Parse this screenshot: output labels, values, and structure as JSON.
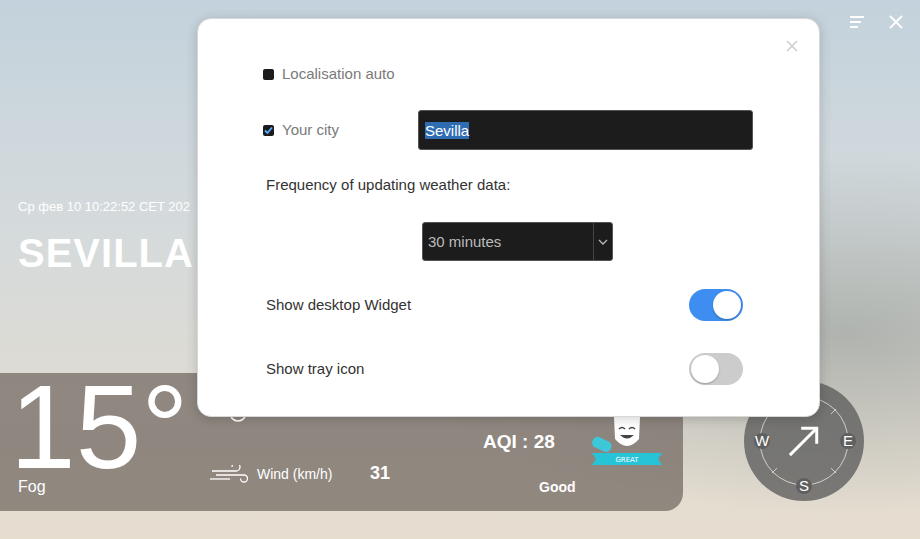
{
  "weather": {
    "datetime": "Ср фев 10 10:22:52 CET 202",
    "city": "SEVILLA",
    "temperature": "15°",
    "condition": "Fog",
    "wind": {
      "label": "Wind (km/h)",
      "value": "31"
    },
    "aqi": {
      "label": "AQI : 28",
      "rating": "Good",
      "badge": "GREAT"
    },
    "compass": {
      "labels": [
        "W",
        "E",
        "S"
      ],
      "bearing": 45
    }
  },
  "settings_dialog": {
    "auto_location": {
      "label": "Localisation auto",
      "checked": false
    },
    "city": {
      "label": "Your city",
      "checked": true,
      "value": "Sevilla",
      "value_selected": true
    },
    "frequency": {
      "label": "Frequency of updating weather data:",
      "value": "30 minutes"
    },
    "toggles": [
      {
        "label": "Show desktop Widget",
        "on": true
      },
      {
        "label": "Show tray icon",
        "on": false
      }
    ]
  }
}
